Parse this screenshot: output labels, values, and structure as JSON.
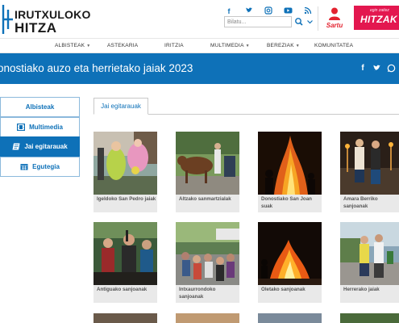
{
  "header": {
    "logo_line1": "IRUTXULOKO",
    "logo_line2": "HITZA",
    "social_icons": [
      "facebook-icon",
      "twitter-icon",
      "instagram-icon",
      "youtube-icon",
      "rss-icon"
    ],
    "search_placeholder": "Bilatu...",
    "login_label": "Sartu",
    "promo_small": "egin zaitez",
    "promo_big": "HITZAK"
  },
  "nav": {
    "items": [
      {
        "label": "ALBISTEAK",
        "dropdown": true
      },
      {
        "label": "ASTEKARIA",
        "dropdown": false
      },
      {
        "label": "IRITZIA",
        "dropdown": false
      },
      {
        "label": "MULTIMEDIA",
        "dropdown": true
      },
      {
        "label": "BEREZIAK",
        "dropdown": true
      },
      {
        "label": "KOMUNITATEA",
        "dropdown": false
      }
    ]
  },
  "band": {
    "title": "onostiako auzo eta herrietako jaiak 2023",
    "social_icons": [
      "facebook-icon",
      "twitter-icon",
      "whatsapp-icon"
    ]
  },
  "sidebar": {
    "items": [
      {
        "label": "Albisteak",
        "icon": "",
        "active": false
      },
      {
        "label": "Multimedia",
        "icon": "film-icon",
        "active": false
      },
      {
        "label": "Jai egitarauak",
        "icon": "document-icon",
        "active": true
      },
      {
        "label": "Egutegia",
        "icon": "calendar-icon",
        "active": false
      }
    ]
  },
  "tabs": {
    "active_label": "Jai egitarauak"
  },
  "cards": [
    {
      "caption": "Igeldoko San Pedro jaiak"
    },
    {
      "caption": "Altzako sanmartzialak"
    },
    {
      "caption": "Donostiako San Joan suak"
    },
    {
      "caption": "Amara Berriko sanjoanak"
    },
    {
      "caption": "Antiguako sanjoanak"
    },
    {
      "caption": "Intxaurrondoko sanjoanak"
    },
    {
      "caption": "Oletako sanjoanak"
    },
    {
      "caption": "Herrerako jaiak"
    }
  ],
  "colors": {
    "brand_blue": "#0e71b8",
    "accent_red": "#e3222f",
    "promo_pink": "#e3174f"
  }
}
